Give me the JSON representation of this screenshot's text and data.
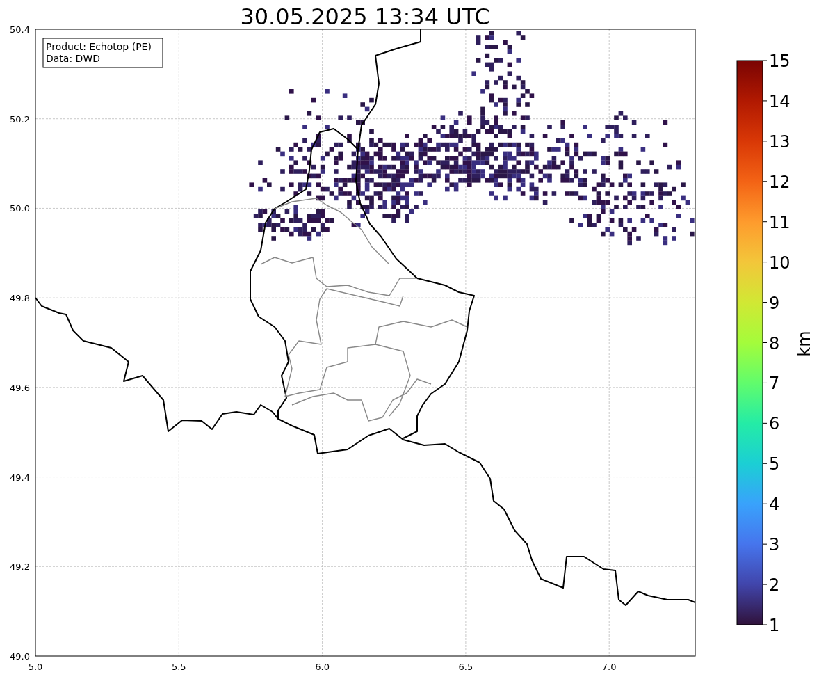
{
  "title": "30.05.2025 13:34 UTC",
  "info_box": [
    "Product: Echotop (PE)",
    "Data: DWD"
  ],
  "x_ticks": [
    "5.0",
    "5.5",
    "6.0",
    "6.5",
    "7.0"
  ],
  "y_ticks": [
    "50.4",
    "50.2",
    "50.0",
    "49.8",
    "49.6",
    "49.4",
    "49.2",
    "49.0"
  ],
  "colorbar": {
    "label": "km",
    "ticks": [
      "15",
      "14",
      "13",
      "12",
      "11",
      "10",
      "9",
      "8",
      "7",
      "6",
      "5",
      "4",
      "3",
      "2",
      "1"
    ]
  }
}
